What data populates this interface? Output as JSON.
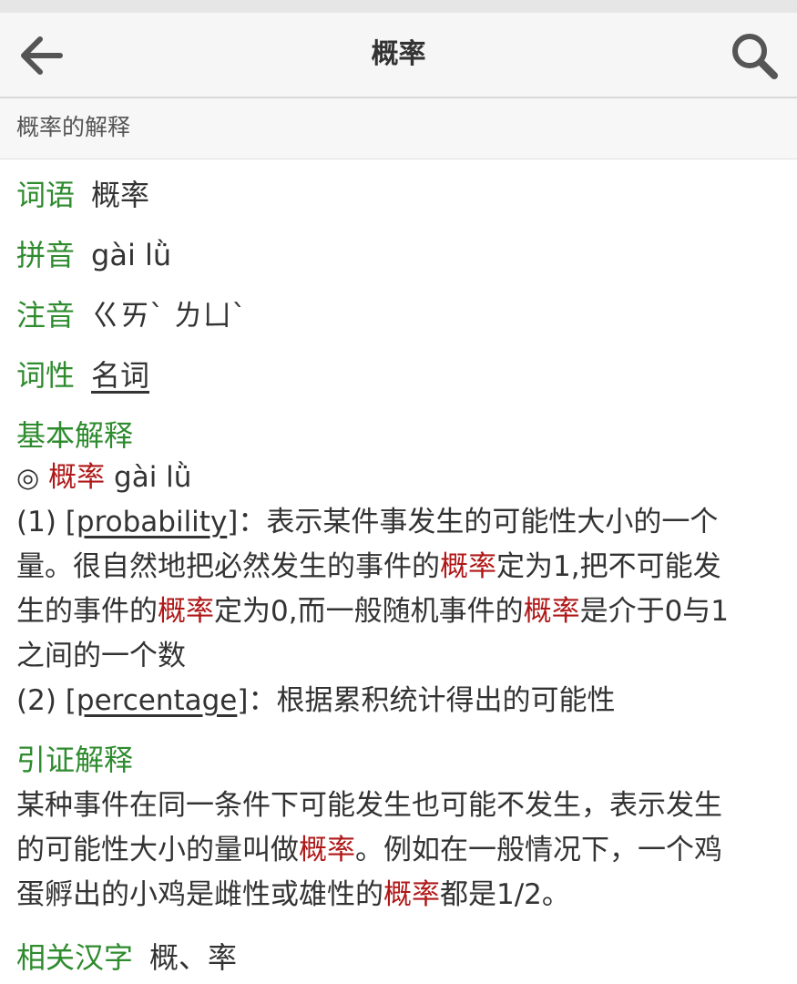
{
  "app": {
    "title": "概率",
    "back_icon": "arrow-left-icon",
    "search_icon": "search-icon"
  },
  "subheader": {
    "text": "概率的解释"
  },
  "entry": {
    "word_label": "词语",
    "word": "概率",
    "pinyin_label": "拼音",
    "pinyin": "gài lǜ",
    "zhuyin_label": "注音",
    "zhuyin": "ㄍㄞˋ ㄌㄩˋ",
    "pos_label": "词性",
    "pos": "名词"
  },
  "basic": {
    "title": "基本解释",
    "circle": "◎",
    "headword": "概率",
    "headword_pinyin": "gài lǜ",
    "def1": {
      "num": "(1)",
      "open_bracket": "[",
      "eng": "probability",
      "close_bracket": "]",
      "line1_rest": "：表示某件事发生的可能性大小的一个",
      "line2_pre": "量。很自然地把必然发生的事件的",
      "hl": "概率",
      "line2_post": "定为1,把不可能发",
      "line3_pre": "生的事件的",
      "line3_mid": "定为0,而一般随机事件的",
      "line3_post": "是介于0与1",
      "line4": "之间的一个数"
    },
    "def2": {
      "num": "(2)",
      "open_bracket": "[",
      "eng": "percentage",
      "close_bracket": "]",
      "rest": "：根据累积统计得出的可能性"
    }
  },
  "cited": {
    "title": "引证解释",
    "line1": "某种事件在同一条件下可能发生也可能不发生，表示发生",
    "line2_pre": "的可能性大小的量叫做",
    "hl": "概率",
    "line2_post": "。例如在一般情况下，一个鸡",
    "line3_pre": "蛋孵出的小鸡是雌性或雄性的",
    "line3_post": "都是1/2。"
  },
  "related": {
    "label": "相关汉字",
    "char1": "概",
    "sep": "、",
    "char2": "率"
  },
  "colors": {
    "label_green": "#2e8b2e",
    "highlight_red": "#b01818",
    "text": "#333333",
    "appbar_bg": "#f6f6f6"
  }
}
